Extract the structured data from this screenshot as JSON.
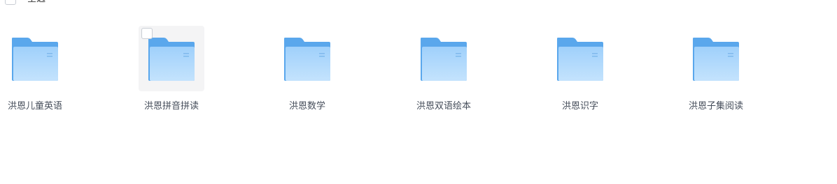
{
  "toolbar": {
    "select_all_label": "全选"
  },
  "folders": [
    {
      "name": "洪恩儿童英语",
      "icon": "folder-icon"
    },
    {
      "name": "洪恩拼音拼读",
      "icon": "folder-icon",
      "hovered": true
    },
    {
      "name": "洪恩数学",
      "icon": "folder-icon"
    },
    {
      "name": "洪恩双语绘本",
      "icon": "folder-icon"
    },
    {
      "name": "洪恩识字",
      "icon": "folder-icon"
    },
    {
      "name": "洪恩子集阅读",
      "icon": "folder-icon"
    }
  ],
  "colors": {
    "folder_back": "#5aa7ec",
    "folder_front_top": "#9fd0fb",
    "folder_front_bottom": "#c4e3fd",
    "hover_bg": "#f4f4f5",
    "text": "#454d5a"
  }
}
